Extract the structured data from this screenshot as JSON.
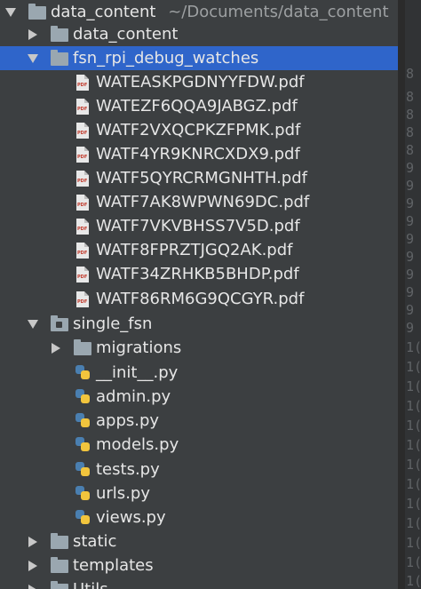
{
  "project": {
    "root_label": "data_content",
    "root_path": "~/Documents/data_content",
    "items": [
      {
        "label": "data_content",
        "type": "folder"
      },
      {
        "label": "fsn_rpi_debug_watches",
        "type": "folder"
      },
      {
        "label": "WATEASKPGDNYYFDW.pdf",
        "type": "pdf"
      },
      {
        "label": "WATEZF6QQA9JABGZ.pdf",
        "type": "pdf"
      },
      {
        "label": "WATF2VXQCPKZFPMK.pdf",
        "type": "pdf"
      },
      {
        "label": "WATF4YR9KNRCXDX9.pdf",
        "type": "pdf"
      },
      {
        "label": "WATF5QYRCRMGNHTH.pdf",
        "type": "pdf"
      },
      {
        "label": "WATF7AK8WPWN69DC.pdf",
        "type": "pdf"
      },
      {
        "label": "WATF7VKVBHSS7V5D.pdf",
        "type": "pdf"
      },
      {
        "label": "WATF8FPRZTJGQ2AK.pdf",
        "type": "pdf"
      },
      {
        "label": "WATF34ZRHKB5BHDP.pdf",
        "type": "pdf"
      },
      {
        "label": "WATF86RM6G9QCGYR.pdf",
        "type": "pdf"
      },
      {
        "label": "single_fsn",
        "type": "module-folder"
      },
      {
        "label": "migrations",
        "type": "folder"
      },
      {
        "label": "__init__.py",
        "type": "python"
      },
      {
        "label": "admin.py",
        "type": "python"
      },
      {
        "label": "apps.py",
        "type": "python"
      },
      {
        "label": "models.py",
        "type": "python"
      },
      {
        "label": "tests.py",
        "type": "python"
      },
      {
        "label": "urls.py",
        "type": "python"
      },
      {
        "label": "views.py",
        "type": "python"
      },
      {
        "label": "static",
        "type": "folder"
      },
      {
        "label": "templates",
        "type": "folder"
      },
      {
        "label": "Utils",
        "type": "folder"
      }
    ]
  },
  "gutter": {
    "lines": [
      "8",
      "8",
      "8",
      "8",
      "8",
      "9",
      "9",
      "9",
      "9",
      "9",
      "9",
      "9",
      "9",
      "9",
      "9",
      "1(",
      "1(",
      "1(",
      "1(",
      "1(",
      "1(",
      "1(",
      "1(",
      "1(",
      "1(",
      "1(",
      "1(",
      "1(",
      "1(",
      "1(",
      "1(",
      "1(",
      "1("
    ]
  },
  "colors": {
    "background": "#3c3f41",
    "selection": "#2f65ca",
    "folder": "#9aa7b0",
    "text": "#e6e6e6",
    "path": "#9da0a2"
  }
}
